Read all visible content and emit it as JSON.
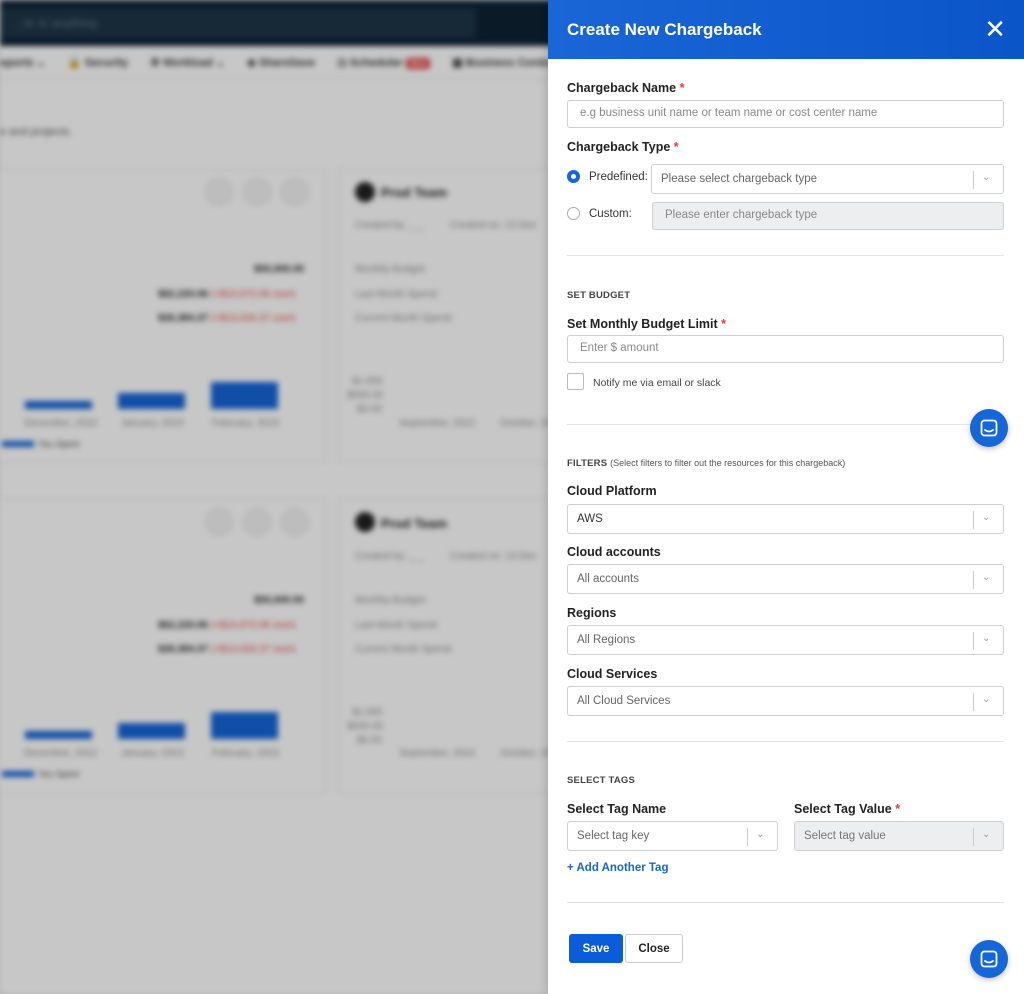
{
  "background": {
    "search_placeholder": "...te or anything",
    "nav": [
      {
        "label": "eports",
        "icon": "chevron-down-icon"
      },
      {
        "label": "Security",
        "icon": "lock-icon"
      },
      {
        "label": "Workload",
        "icon": "gear-icon"
      },
      {
        "label": "ShareSave",
        "icon": "tag-icon"
      },
      {
        "label": "Scheduler",
        "icon": "clock-icon",
        "badge": "New"
      },
      {
        "label": "Business Contexts",
        "icon": "building-icon"
      }
    ],
    "description": "e and projects.",
    "cards": [
      {
        "team": "Prod Team",
        "created_by": "Created by: _ _",
        "created_on": "Created on: 13 Dec",
        "budget_value": "$50,000.00",
        "last_month": "$62,220.06",
        "last_month_over": "(+$10,072.06 over)",
        "current_month": "$30,384.37",
        "current_month_over": "(+$13,034.37 over)",
        "metric_labels": [
          "Monthly Budget:",
          "Last Month Spend:",
          "Current Month Spend:"
        ],
        "months_left": [
          "December, 2022",
          "January, 2023",
          "February, 2023"
        ],
        "months_right": [
          "September, 2022",
          "October, 20"
        ],
        "yticks": [
          "$1,000",
          "$500.00",
          "$0.00"
        ],
        "legend": "You Spent"
      },
      {
        "team": "Prod Team",
        "created_by": "Created by: _ _",
        "created_on": "Created on: 13 Dec",
        "budget_value": "$50,000.00",
        "last_month": "$62,220.06",
        "last_month_over": "(+$10,072.06 over)",
        "current_month": "$30,384.37",
        "current_month_over": "(+$13,034.37 over)",
        "metric_labels": [
          "Monthly Budget:",
          "Last Month Spend:",
          "Current Month Spend:"
        ],
        "months_left": [
          "December, 2022",
          "January, 2023",
          "February, 2023"
        ],
        "months_right": [
          "September, 2022",
          "October, 20"
        ],
        "yticks": [
          "$1,000",
          "$500.00",
          "$0.00"
        ],
        "legend": "You Spent"
      }
    ]
  },
  "drawer": {
    "title": "Create New Chargeback",
    "close_icon": "close-icon",
    "accent": "#1566d8",
    "chargeback_name": {
      "label": "Chargeback Name",
      "required": "*",
      "placeholder": "e.g business unit name or team name or cost center name"
    },
    "chargeback_type": {
      "label": "Chargeback Type",
      "required": "*",
      "predefined_label": "Predefined:",
      "predefined_placeholder": "Please select chargeback type",
      "custom_label": "Custom:",
      "custom_placeholder": "Please enter chargeback type",
      "selected": "predefined"
    },
    "budget": {
      "section": "SET BUDGET",
      "label": "Set Monthly Budget Limit",
      "required": "*",
      "placeholder": "Enter $ amount",
      "notify_label": "Notify me via email or slack",
      "notify_checked": false
    },
    "filters": {
      "section": "FILTERS",
      "note": "(Select filters to filter out the resources for this chargeback)",
      "cloud_platform": {
        "label": "Cloud Platform",
        "value": "AWS"
      },
      "cloud_accounts": {
        "label": "Cloud accounts",
        "value": "All accounts"
      },
      "regions": {
        "label": "Regions",
        "value": "All Regions"
      },
      "cloud_services": {
        "label": "Cloud Services",
        "value": "All Cloud Services"
      }
    },
    "tags": {
      "section": "SELECT TAGS",
      "name_label": "Select Tag Name",
      "value_label": "Select Tag Value",
      "required": "*",
      "name_placeholder": "Select tag key",
      "value_placeholder": "Select tag value",
      "add_link": "+ Add Another Tag"
    },
    "actions": {
      "save": "Save",
      "close": "Close"
    },
    "chat_icon": "chat-icon"
  }
}
